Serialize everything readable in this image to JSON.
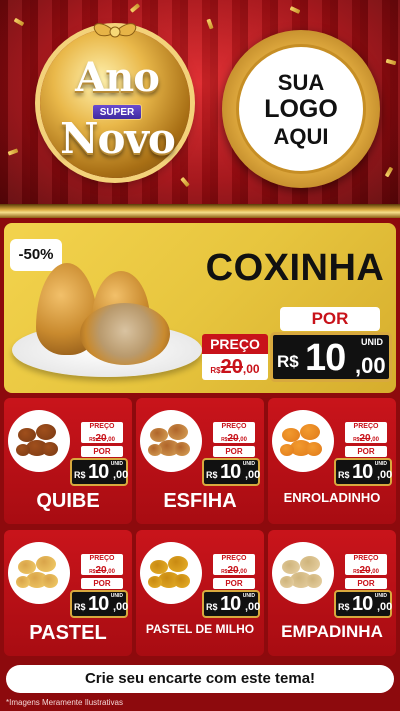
{
  "header": {
    "seal": {
      "line1": "Ano",
      "badge": "SUPER",
      "line2": "Novo"
    },
    "logo_placeholder": [
      "SUA",
      "LOGO",
      "AQUI"
    ]
  },
  "featured": {
    "discount": "-50%",
    "name": "COXINHA",
    "por_label": "POR",
    "preco_label": "PREÇO",
    "old_price": {
      "currency": "R$",
      "integer": "20",
      "cents": ",00"
    },
    "price": {
      "unit": "UNID",
      "currency": "R$",
      "integer": "10",
      "cents": ",00"
    }
  },
  "products": [
    {
      "name": "QUIBE",
      "preco_label": "PREÇO",
      "por_label": "POR",
      "old_price": {
        "currency": "R$",
        "integer": "20",
        "cents": ",00"
      },
      "price": {
        "unit": "UNID",
        "currency": "R$",
        "integer": "10",
        "cents": ",00"
      }
    },
    {
      "name": "ESFIHA",
      "preco_label": "PREÇO",
      "por_label": "POR",
      "old_price": {
        "currency": "R$",
        "integer": "20",
        "cents": ",00"
      },
      "price": {
        "unit": "UNID",
        "currency": "R$",
        "integer": "10",
        "cents": ",00"
      }
    },
    {
      "name": "ENROLADINHO",
      "preco_label": "PREÇO",
      "por_label": "POR",
      "old_price": {
        "currency": "R$",
        "integer": "20",
        "cents": ",00"
      },
      "price": {
        "unit": "UNID",
        "currency": "R$",
        "integer": "10",
        "cents": ",00"
      }
    },
    {
      "name": "PASTEL",
      "preco_label": "PREÇO",
      "por_label": "POR",
      "old_price": {
        "currency": "R$",
        "integer": "20",
        "cents": ",00"
      },
      "price": {
        "unit": "UNID",
        "currency": "R$",
        "integer": "10",
        "cents": ",00"
      }
    },
    {
      "name": "PASTEL DE MILHO",
      "preco_label": "PREÇO",
      "por_label": "POR",
      "old_price": {
        "currency": "R$",
        "integer": "20",
        "cents": ",00"
      },
      "price": {
        "unit": "UNID",
        "currency": "R$",
        "integer": "10",
        "cents": ",00"
      }
    },
    {
      "name": "EMPADINHA",
      "preco_label": "PREÇO",
      "por_label": "POR",
      "old_price": {
        "currency": "R$",
        "integer": "20",
        "cents": ",00"
      },
      "price": {
        "unit": "UNID",
        "currency": "R$",
        "integer": "10",
        "cents": ",00"
      }
    }
  ],
  "footer": {
    "cta": "Crie seu encarte com este tema!",
    "disclaimer": "*Imagens Meramente Ilustrativas"
  },
  "colors": {
    "primary_red": "#c8121a",
    "gold": "#d8a93e",
    "yellow_card": "#e7c53e",
    "price_black": "#111111"
  }
}
